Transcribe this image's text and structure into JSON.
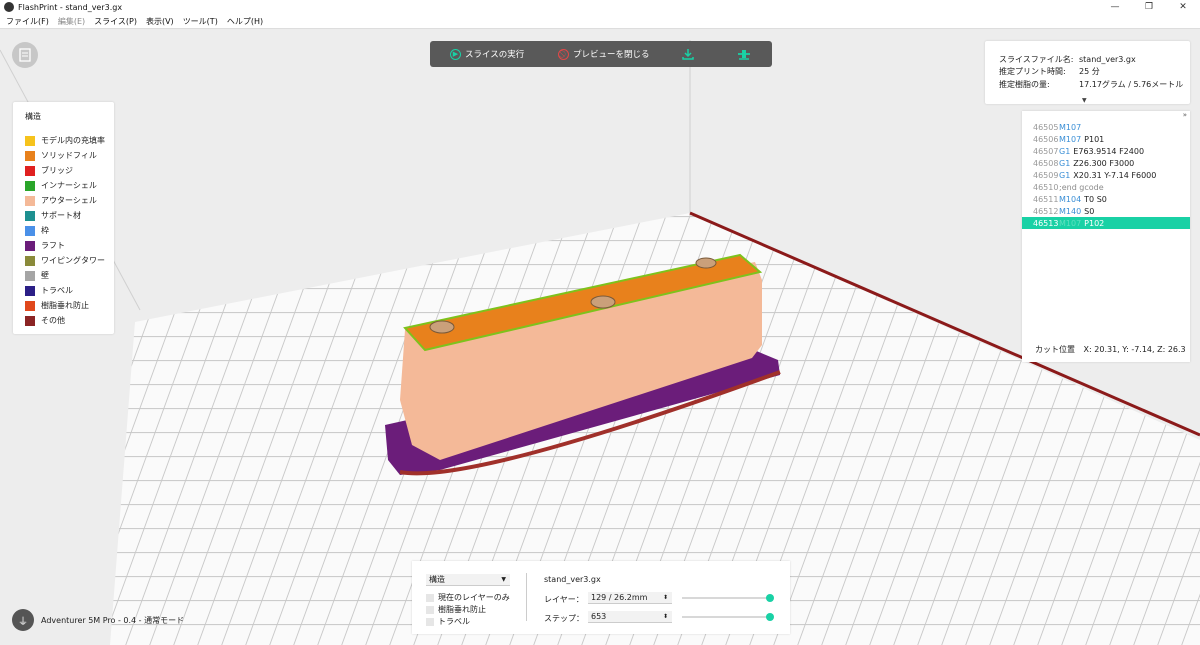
{
  "window": {
    "title": "FlashPrint - stand_ver3.gx",
    "minimize": "—",
    "maximize": "❐",
    "close": "✕"
  },
  "menu": [
    "ファイル(F)",
    "編集(E)",
    "スライス(P)",
    "表示(V)",
    "ツール(T)",
    "ヘルプ(H)"
  ],
  "toolbar": {
    "run_slice": "スライスの実行",
    "close_preview": "プレビューを閉じる",
    "icons": [
      "play-icon",
      "no-entry-icon",
      "download-icon",
      "printer-connect-icon"
    ]
  },
  "legend": {
    "title": "構造",
    "items": [
      {
        "label": "モデル内の充填率",
        "color": "#f6c31c"
      },
      {
        "label": "ソリッドフィル",
        "color": "#e8811c"
      },
      {
        "label": "ブリッジ",
        "color": "#e02020"
      },
      {
        "label": "インナーシェル",
        "color": "#2aa52a"
      },
      {
        "label": "アウターシェル",
        "color": "#f4b998"
      },
      {
        "label": "サポート材",
        "color": "#1e9090"
      },
      {
        "label": "枠",
        "color": "#4a90e8"
      },
      {
        "label": "ラフト",
        "color": "#6b1d7a"
      },
      {
        "label": "ワイピングタワー",
        "color": "#8a8a3a"
      },
      {
        "label": "壁",
        "color": "#a5a5a5"
      },
      {
        "label": "トラベル",
        "color": "#2b1f87"
      },
      {
        "label": "樹脂垂れ防止",
        "color": "#e0481c"
      },
      {
        "label": "その他",
        "color": "#8b2424"
      }
    ]
  },
  "info": {
    "file_label": "スライスファイル名:",
    "file_value": "stand_ver3.gx",
    "time_label": "推定プリント時間:",
    "time_value": "25 分",
    "resin_label": "推定樹脂の量:",
    "resin_value": "17.17グラム / 5.76メートル",
    "collapse": "▼"
  },
  "gcode": {
    "expand": "»",
    "lines": [
      {
        "num": "46505",
        "cmd": "M107",
        "args": "",
        "comment": ""
      },
      {
        "num": "46506",
        "cmd": "M107",
        "args": "P101",
        "comment": ""
      },
      {
        "num": "46507",
        "cmd": "G1",
        "args": "E763.9514 F2400",
        "comment": ""
      },
      {
        "num": "46508",
        "cmd": "G1",
        "args": "Z26.300 F3000",
        "comment": ""
      },
      {
        "num": "46509",
        "cmd": "G1",
        "args": "X20.31 Y-7.14 F6000",
        "comment": ""
      },
      {
        "num": "46510",
        "cmd": "",
        "args": "",
        "comment": ";end gcode"
      },
      {
        "num": "46511",
        "cmd": "M104",
        "args": "T0 S0",
        "comment": ""
      },
      {
        "num": "46512",
        "cmd": "M140",
        "args": "S0",
        "comment": ""
      },
      {
        "num": "46513",
        "cmd": "M107",
        "args": "P102",
        "comment": ""
      }
    ],
    "active_index": 8,
    "cut_label": "カット位置",
    "cut_value": "X: 20.31, Y: -7.14, Z: 26.3"
  },
  "bottom": {
    "select_value": "構造",
    "checkboxes": [
      "現在のレイヤーのみ",
      "樹脂垂れ防止",
      "トラベル"
    ],
    "file": "stand_ver3.gx",
    "layer_label": "レイヤー：",
    "layer_value": "129 / 26.2mm",
    "step_label": "ステップ：",
    "step_value": "653",
    "layer_slider": 1.0,
    "step_slider": 1.0
  },
  "machine": {
    "label": "Adventurer 5M Pro - 0.4 - 通常モード"
  },
  "colors": {
    "accent": "#19d1a5",
    "toolbar_bg": "#595959",
    "gcode_cmd": "#3b8fd6"
  }
}
